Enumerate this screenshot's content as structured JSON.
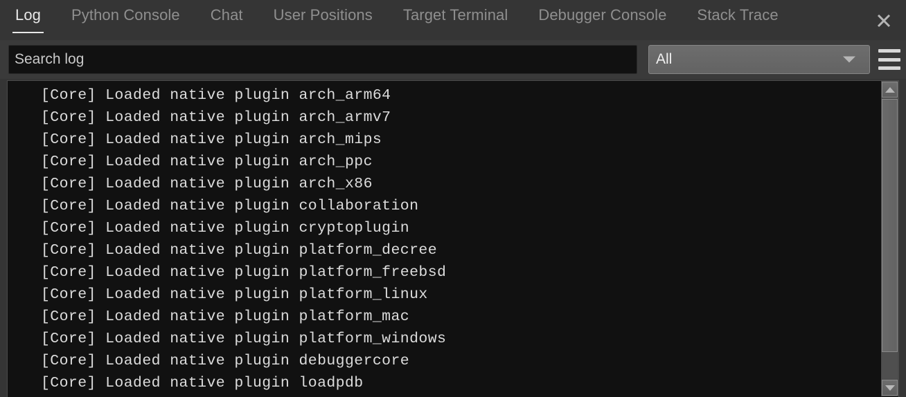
{
  "tabs": [
    {
      "label": "Log",
      "active": true
    },
    {
      "label": "Python Console",
      "active": false
    },
    {
      "label": "Chat",
      "active": false
    },
    {
      "label": "User Positions",
      "active": false
    },
    {
      "label": "Target Terminal",
      "active": false
    },
    {
      "label": "Debugger Console",
      "active": false
    },
    {
      "label": "Stack Trace",
      "active": false
    }
  ],
  "close_icon": "✕",
  "toolbar": {
    "search_placeholder": "Search log",
    "search_value": "",
    "filter_selected": "All",
    "filter_options": [
      "All"
    ],
    "menu_icon": "hamburger-icon"
  },
  "log": {
    "lines": [
      "[Core] Loaded native plugin arch_arm64",
      "[Core] Loaded native plugin arch_armv7",
      "[Core] Loaded native plugin arch_mips",
      "[Core] Loaded native plugin arch_ppc",
      "[Core] Loaded native plugin arch_x86",
      "[Core] Loaded native plugin collaboration",
      "[Core] Loaded native plugin cryptoplugin",
      "[Core] Loaded native plugin platform_decree",
      "[Core] Loaded native plugin platform_freebsd",
      "[Core] Loaded native plugin platform_linux",
      "[Core] Loaded native plugin platform_mac",
      "[Core] Loaded native plugin platform_windows",
      "[Core] Loaded native plugin debuggercore",
      "[Core] Loaded native plugin loadpdb"
    ]
  },
  "colors": {
    "window_bg": "#353535",
    "toolbar_bg": "#3a3a3a",
    "log_bg": "#111111",
    "log_text": "#dcdcdc",
    "tab_active_text": "#e8e8e8",
    "tab_inactive_text": "#8f8f8f",
    "control_face": "#6a6a6a"
  }
}
